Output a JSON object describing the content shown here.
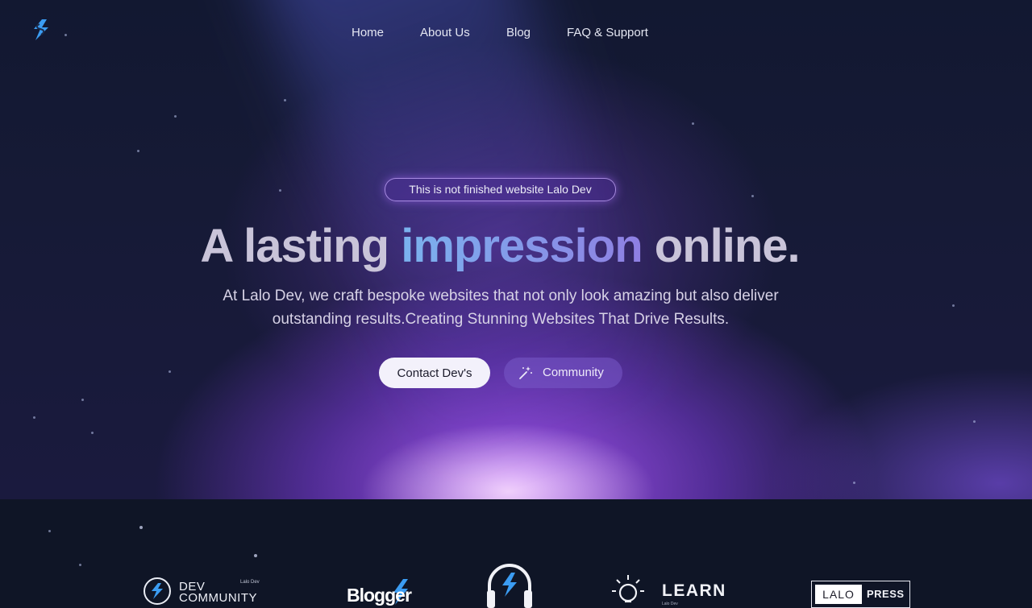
{
  "nav": {
    "logo_icon": "bolt-s-logo-icon",
    "items": [
      {
        "label": "Home"
      },
      {
        "label": "About Us"
      },
      {
        "label": "Blog"
      },
      {
        "label": "FAQ & Support"
      }
    ]
  },
  "hero": {
    "badge": "This is not finished website Lalo Dev",
    "headline_pre": "A lasting ",
    "headline_accent": "impression",
    "headline_post": " online.",
    "subtitle": "At Lalo Dev, we craft bespoke websites that not only look amazing but also deliver outstanding results.Creating Stunning Websites That Drive Results.",
    "primary_button": "Contact Dev's",
    "secondary_button": "Community",
    "secondary_button_icon": "magic-wand-icon"
  },
  "partners": {
    "dev_community": {
      "line1": "DEV",
      "line2": "COMMUNITY",
      "tag": "Lalo Dev"
    },
    "blogger": {
      "label": "Blogger"
    },
    "headphones_icon": "headphones-bolt-icon",
    "learn": {
      "label": "LEARN",
      "tag": "Lalo Dev"
    },
    "press": {
      "left": "LALO",
      "right": "PRESS"
    }
  },
  "colors": {
    "background": "#0f1526",
    "accent_blue": "#7ab3ee",
    "accent_purple": "#a855f7",
    "bolt_blue": "#3b9cf2"
  }
}
